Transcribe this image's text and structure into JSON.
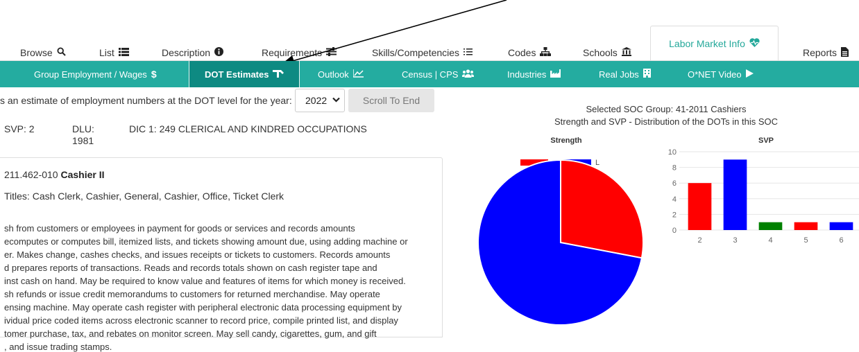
{
  "top_tabs": [
    {
      "label": "Browse",
      "icon": "search-icon"
    },
    {
      "label": "List",
      "icon": "list-icon"
    },
    {
      "label": "Description",
      "icon": "info-icon"
    },
    {
      "label": "Requirements",
      "icon": "sliders-icon"
    },
    {
      "label": "Skills/Competencies",
      "icon": "checklist-icon"
    },
    {
      "label": "Codes",
      "icon": "hierarchy-icon"
    },
    {
      "label": "Schools",
      "icon": "bank-icon"
    },
    {
      "label": "Labor Market Info",
      "icon": "heart-icon"
    },
    {
      "label": "Reports",
      "icon": "document-icon"
    }
  ],
  "sub_tabs": [
    {
      "label": "Group Employment / Wages",
      "icon": "dollar-icon"
    },
    {
      "label": "DOT Estimates",
      "icon": "tools-icon"
    },
    {
      "label": "Outlook",
      "icon": "chart-icon"
    },
    {
      "label": "Census | CPS",
      "icon": "users-icon"
    },
    {
      "label": "Industries",
      "icon": "industry-icon"
    },
    {
      "label": "Real Jobs",
      "icon": "building-icon"
    },
    {
      "label": "O*NET Video",
      "icon": "play-icon"
    }
  ],
  "estimate": {
    "text": "s an estimate of employment numbers at the DOT level for the year:",
    "year": "2022",
    "scroll_label": "Scroll To End"
  },
  "dot_info": {
    "svp": "SVP: 2",
    "dlu_label": "DLU:",
    "dlu_year": "1981",
    "dic": "DIC 1: 249 CLERICAL AND KINDRED OCCUPATIONS"
  },
  "description": {
    "code": "211.462-010",
    "title": "Cashier II",
    "alt_titles": "Titles: Cash Clerk, Cashier, General, Cashier, Office, Ticket Clerk",
    "lines": [
      "sh from customers or employees in payment for goods or services and records amounts",
      "ecomputes or computes bill, itemized lists, and tickets showing amount due, using adding machine or",
      "er. Makes change, cashes checks, and issues receipts or tickets to customers. Records amounts",
      "d prepares reports of transactions. Reads and records totals shown on cash register tape and",
      "inst cash on hand. May be required to know value and features of items for which money is received.",
      "sh refunds or issue credit memorandums to customers for returned merchandise. May operate",
      "ensing machine. May operate cash register with peripheral electronic data processing equipment by",
      "ividual price coded items across electronic scanner to record price, compile printed list, and display",
      "tomer purchase, tax, and rebates on monitor screen. May sell candy, cigarettes, gum, and gift",
      ", and issue trading stamps."
    ]
  },
  "chart_header": {
    "line1": "Selected SOC Group: 41-2011 Cashiers",
    "line2": "Strength and SVP - Distribution of the DOTs in this SOC"
  },
  "chart_data": [
    {
      "type": "pie",
      "title": "Strength",
      "categories": [
        "S",
        "L"
      ],
      "values": [
        0.28,
        0.72
      ],
      "colors": [
        "#ff0000",
        "#0000ff"
      ],
      "legend": "top"
    },
    {
      "type": "bar",
      "title": "SVP",
      "categories": [
        "2",
        "3",
        "4",
        "5",
        "6"
      ],
      "values": [
        6,
        9,
        1,
        1,
        1
      ],
      "colors": [
        "#ff0000",
        "#0000ff",
        "#008000",
        "#ff0000",
        "#0000ff"
      ],
      "ylim": [
        0,
        10
      ],
      "yticks": [
        0,
        2,
        4,
        6,
        8,
        10
      ],
      "grid": true
    }
  ]
}
